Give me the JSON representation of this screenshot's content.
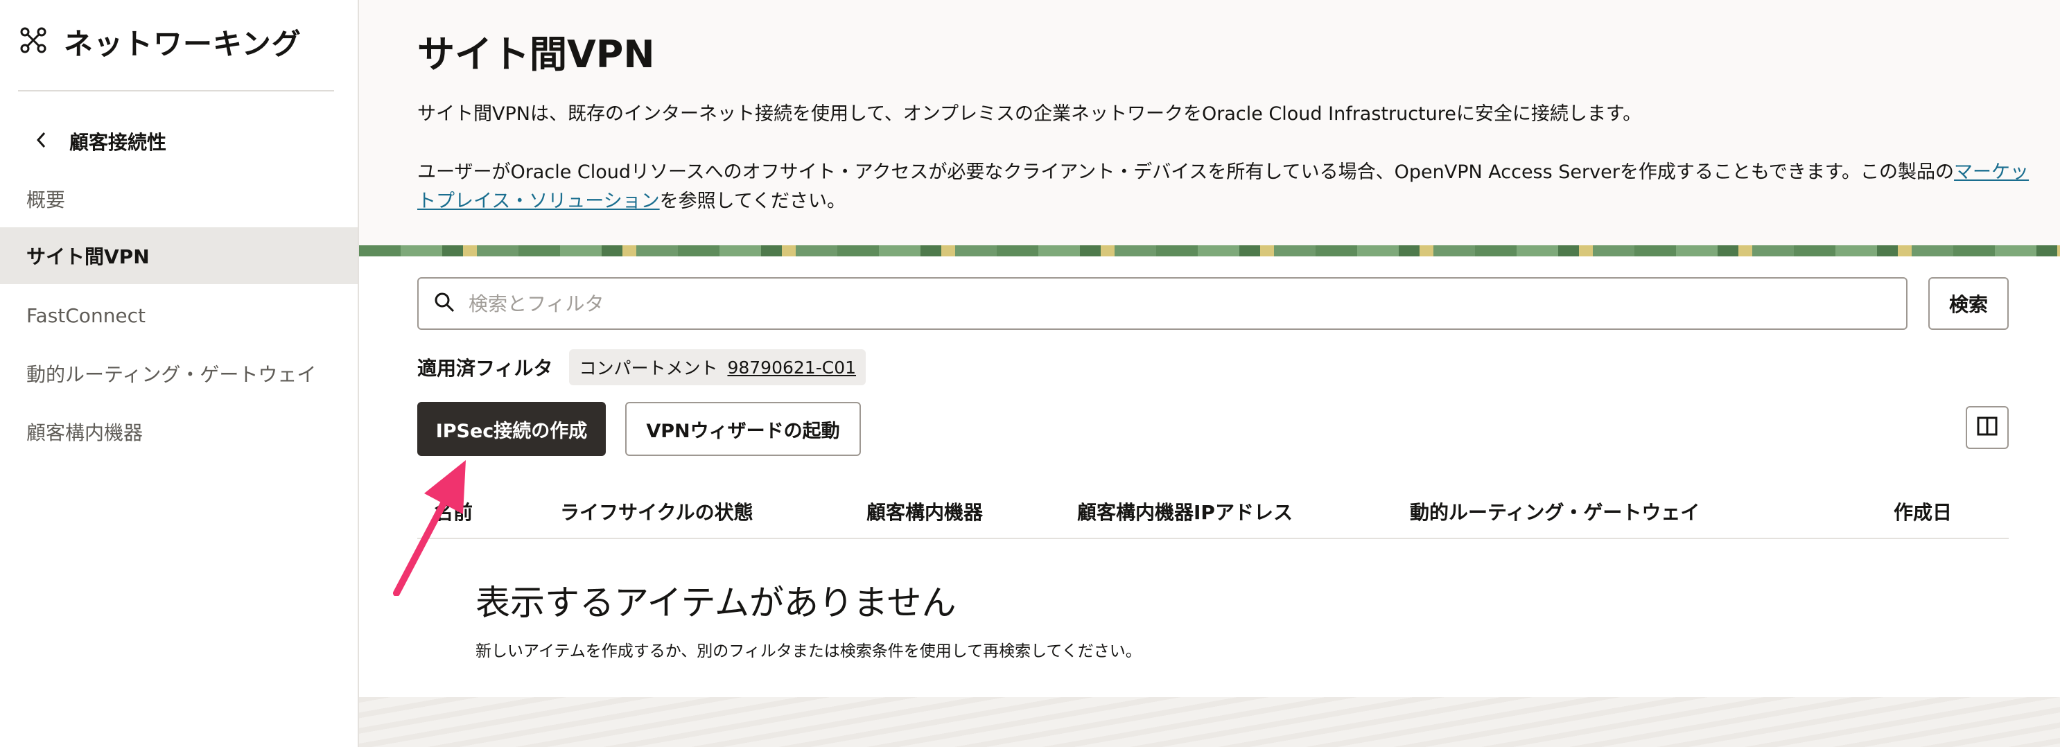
{
  "sidebar": {
    "title": "ネットワーキング",
    "back_label": "顧客接続性",
    "items": [
      {
        "label": "概要",
        "active": false
      },
      {
        "label": "サイト間VPN",
        "active": true
      },
      {
        "label": "FastConnect",
        "active": false
      },
      {
        "label": "動的ルーティング・ゲートウェイ",
        "active": false
      },
      {
        "label": "顧客構内機器",
        "active": false
      }
    ]
  },
  "header": {
    "title": "サイト間VPN",
    "desc1": "サイト間VPNは、既存のインターネット接続を使用して、オンプレミスの企業ネットワークをOracle Cloud Infrastructureに安全に接続します。",
    "desc2_pre": "ユーザーがOracle Cloudリソースへのオフサイト・アクセスが必要なクライアント・デバイスを所有している場合、OpenVPN Access Serverを作成することもできます。この製品の",
    "desc2_link": "マーケットプレイス・ソリューション",
    "desc2_post": "を参照してください。"
  },
  "search": {
    "placeholder": "検索とフィルタ",
    "value": "",
    "button_label": "検索"
  },
  "filters": {
    "label": "適用済フィルタ",
    "chip_key": "コンパートメント",
    "chip_value": "98790621-C01"
  },
  "actions": {
    "create_label": "IPSec接続の作成",
    "wizard_label": "VPNウィザードの起動"
  },
  "table": {
    "columns": [
      "名前",
      "ライフサイクルの状態",
      "顧客構内機器",
      "顧客構内機器IPアドレス",
      "動的ルーティング・ゲートウェイ",
      "作成日"
    ]
  },
  "empty": {
    "title": "表示するアイテムがありません",
    "subtitle": "新しいアイテムを作成するか、別のフィルタまたは検索条件を使用して再検索してください。"
  },
  "colors": {
    "primary_button": "#312d2a",
    "link": "#1a6e8f",
    "arrow": "#f0336e",
    "active_nav_bg": "#e9e7e4"
  }
}
